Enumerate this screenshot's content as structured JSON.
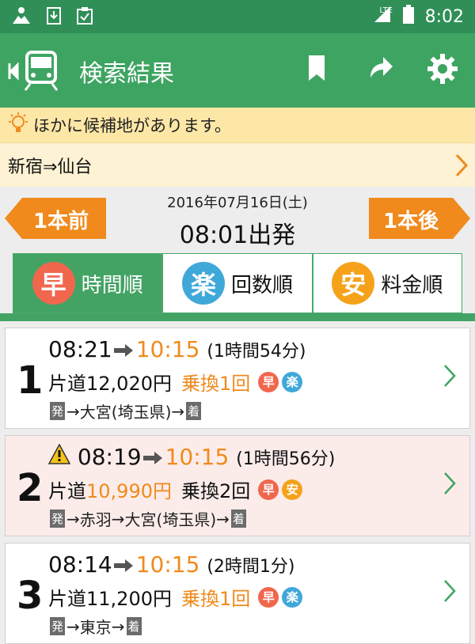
{
  "status_bar": {
    "time": "8:02",
    "network": "LTE"
  },
  "app_bar": {
    "title": "検索結果"
  },
  "notice": {
    "text": "ほかに候補地があります。"
  },
  "route": {
    "text": "新宿⇒仙台"
  },
  "departure": {
    "date": "2016年07月16日(土)",
    "time_label": "08:01出発",
    "prev_label": "1本前",
    "next_label": "1本後"
  },
  "tabs": [
    {
      "badge": "早",
      "label": "時間順",
      "badge_color": "#f0674e"
    },
    {
      "badge": "楽",
      "label": "回数順",
      "badge_color": "#40a8d9"
    },
    {
      "badge": "安",
      "label": "料金順",
      "badge_color": "#f5a21a"
    }
  ],
  "results": [
    {
      "num": "1",
      "dep": "08:21",
      "arr": "10:15",
      "duration": "(1時間54分)",
      "fare_prefix": "片道",
      "fare": "12,020円",
      "transfer": "乗換1回",
      "badges": [
        "早",
        "楽"
      ],
      "via": [
        "発",
        "大宮(埼玉県)",
        "着"
      ]
    },
    {
      "num": "2",
      "dep": "08:19",
      "arr": "10:15",
      "duration": "(1時間56分)",
      "fare_prefix": "片道",
      "fare": "10,990円",
      "transfer": "乗換2回",
      "badges": [
        "早",
        "安"
      ],
      "via": [
        "発",
        "赤羽",
        "大宮(埼玉県)",
        "着"
      ]
    },
    {
      "num": "3",
      "dep": "08:14",
      "arr": "10:15",
      "duration": "(2時間1分)",
      "fare_prefix": "片道",
      "fare": "11,200円",
      "transfer": "乗換1回",
      "badges": [
        "早",
        "楽"
      ],
      "via": [
        "発",
        "東京",
        "着"
      ]
    }
  ],
  "colors": {
    "green_dark": "#2f8f57",
    "green": "#3ea462",
    "orange": "#f08a1c",
    "notice_bg": "#fde7a6"
  }
}
